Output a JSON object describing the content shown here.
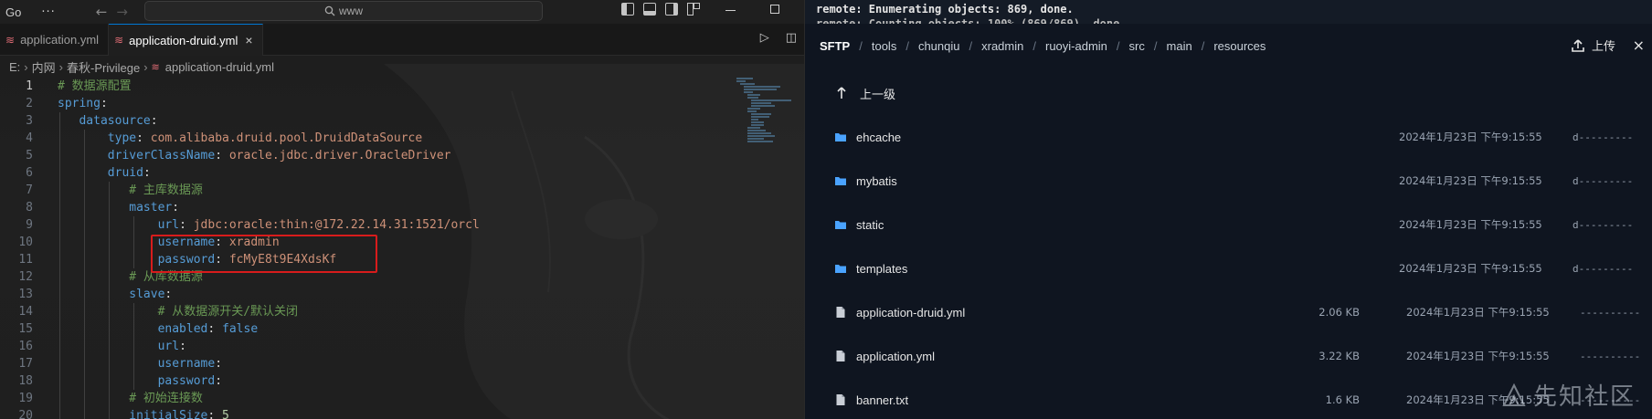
{
  "titlebar": {
    "menu_label": "Go",
    "more_label": "···",
    "search_placeholder": "www"
  },
  "tabs": [
    {
      "label": "application.yml",
      "active": false
    },
    {
      "label": "application-druid.yml",
      "active": true,
      "close": "×"
    }
  ],
  "breadcrumb": {
    "items": [
      "E:",
      "内网",
      "春秋-Privilege",
      "application-druid.yml"
    ]
  },
  "code_lines": [
    {
      "n": "1",
      "html": "<span class=\"c\"># 数据源配置</span>",
      "indent": 0
    },
    {
      "n": "2",
      "html": "<span class=\"k\">spring</span><span class=\"p\">:</span>",
      "indent": 0
    },
    {
      "n": "3",
      "html": "    <span class=\"k\">datasource</span><span class=\"p\">:</span>",
      "indent": 1
    },
    {
      "n": "4",
      "html": "        <span class=\"k\">type</span><span class=\"p\">: </span><span class=\"s\">com.alibaba.druid.pool.DruidDataSource</span>",
      "indent": 2
    },
    {
      "n": "5",
      "html": "        <span class=\"k\">driverClassName</span><span class=\"p\">: </span><span class=\"s\">oracle.jdbc.driver.OracleDriver</span>",
      "indent": 2
    },
    {
      "n": "6",
      "html": "        <span class=\"k\">druid</span><span class=\"p\">:</span>",
      "indent": 2
    },
    {
      "n": "7",
      "html": "            <span class=\"c\"># 主库数据源</span>",
      "indent": 3
    },
    {
      "n": "8",
      "html": "            <span class=\"k\">master</span><span class=\"p\">:</span>",
      "indent": 3
    },
    {
      "n": "9",
      "html": "                <span class=\"k\">url</span><span class=\"p\">: </span><span class=\"s\">jdbc:oracle:thin:@172.22.14.31:1521/orcl</span>",
      "indent": 4
    },
    {
      "n": "10",
      "html": "                <span class=\"k\">username</span><span class=\"p\">: </span><span class=\"s\">xradmin</span>",
      "indent": 4
    },
    {
      "n": "11",
      "html": "                <span class=\"k\">password</span><span class=\"p\">: </span><span class=\"s\">fcMyE8t9E4XdsKf</span>",
      "indent": 4
    },
    {
      "n": "12",
      "html": "            <span class=\"c\"># 从库数据源</span>",
      "indent": 3
    },
    {
      "n": "13",
      "html": "            <span class=\"k\">slave</span><span class=\"p\">:</span>",
      "indent": 3
    },
    {
      "n": "14",
      "html": "                <span class=\"c\"># 从数据源开关/默认关闭</span>",
      "indent": 4
    },
    {
      "n": "15",
      "html": "                <span class=\"k\">enabled</span><span class=\"p\">: </span><span class=\"kw\">false</span>",
      "indent": 4
    },
    {
      "n": "16",
      "html": "                <span class=\"k\">url</span><span class=\"p\">:</span>",
      "indent": 4
    },
    {
      "n": "17",
      "html": "                <span class=\"k\">username</span><span class=\"p\">:</span>",
      "indent": 4
    },
    {
      "n": "18",
      "html": "                <span class=\"k\">password</span><span class=\"p\">:</span>",
      "indent": 4
    },
    {
      "n": "19",
      "html": "            <span class=\"c\"># 初始连接数</span>",
      "indent": 3
    },
    {
      "n": "20",
      "html": "            <span class=\"k\">initialSize</span><span class=\"p\">: </span><span class=\"n\">5</span>",
      "indent": 3
    }
  ],
  "terminal": {
    "line1": "remote: Enumerating objects: 869, done.",
    "line2": "remote: Counting objects: 100% (869/869), done."
  },
  "sftp": {
    "root": "SFTP",
    "path": [
      "tools",
      "chunqiu",
      "xradmin",
      "ruoyi-admin",
      "src",
      "main",
      "resources"
    ],
    "upload_label": "上传",
    "close": "×",
    "parent_label": "上一级",
    "entries": [
      {
        "type": "folder",
        "name": "ehcache",
        "size": "",
        "date": "2024年1月23日 下午9:15:55",
        "perm": "d---------"
      },
      {
        "type": "folder",
        "name": "mybatis",
        "size": "",
        "date": "2024年1月23日 下午9:15:55",
        "perm": "d---------"
      },
      {
        "type": "folder",
        "name": "static",
        "size": "",
        "date": "2024年1月23日 下午9:15:55",
        "perm": "d---------"
      },
      {
        "type": "folder",
        "name": "templates",
        "size": "",
        "date": "2024年1月23日 下午9:15:55",
        "perm": "d---------"
      },
      {
        "type": "file",
        "name": "application-druid.yml",
        "size": "2.06 KB",
        "date": "2024年1月23日 下午9:15:55",
        "perm": "----------"
      },
      {
        "type": "file",
        "name": "application.yml",
        "size": "3.22 KB",
        "date": "2024年1月23日 下午9:15:55",
        "perm": "----------"
      },
      {
        "type": "file",
        "name": "banner.txt",
        "size": "1.6 KB",
        "date": "2024年1月23日 下午9:15:55",
        "perm": "----------"
      }
    ]
  },
  "watermark": {
    "text": "先知社区"
  },
  "colors": {
    "accent": "#0078d4",
    "folder": "#4aa3ff",
    "highlight": "#d81c1c"
  }
}
